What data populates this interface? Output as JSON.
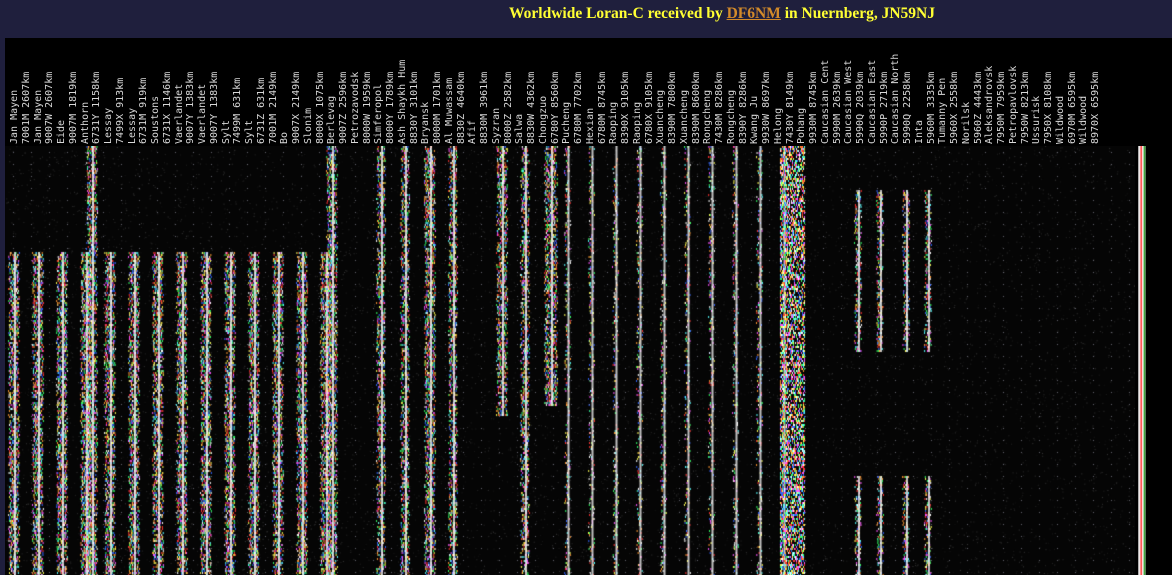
{
  "header": {
    "prefix": "Worldwide Loran-C received by ",
    "link": "DF6NM",
    "suffix": " in Nuernberg, JN59NJ"
  },
  "stations": [
    "Jan Mayen",
    "7001M 2607km",
    "Jan Mayen",
    "9007W 2607km",
    "Eide",
    "9007M 1819km",
    "Anthorn",
    "6731Y 1158km",
    "Lessay",
    "7499X 913km",
    "Lessay",
    "6731M 919km",
    "Soustons",
    "6731X 1146km",
    "Vaerlandet",
    "9007Y 1383km",
    "Vaerlandet",
    "9007Y 1383km",
    "Sylt",
    "7499M 631km",
    "Sylt",
    "6731Z 631km",
    "7001M 2149km",
    "Bo",
    "9007X 2149km",
    "Slonim",
    "8000X 1075km",
    "Berlevag",
    "9007Z 2596km",
    "Petrozavodsk",
    "8000W 1959km",
    "Simferopol",
    "8000Y 1789km",
    "Ash Shaykh Hum",
    "8830Y 3101km",
    "Bryansk",
    "8000M 1701km",
    "Al Muwassam",
    "8830Z 4640km",
    "Afif",
    "8830M 3961km",
    "Syzran",
    "8000Z 2582km",
    "Salwa",
    "8830W 4362km",
    "Chongzuo",
    "6780Y 8560km",
    "Pucheng",
    "6780M 7702km",
    "Hexian",
    "6780M 8745km",
    "Raoping",
    "8390X 9105km",
    "Raoping",
    "6780X 9105km",
    "Xuancheng",
    "8390M 7800km",
    "Xuancheng",
    "8390M 8600km",
    "Rongcheng",
    "7430M 8286km",
    "Rongcheng",
    "8390Y 8286km",
    "Kwang Ju",
    "9930W 8697km",
    "Helong",
    "7430Y 8149km",
    "Pohang",
    "9930M 8745km",
    "Caucasian Cent",
    "5990M 2639km",
    "Caucasian West",
    "5990Q 2039km",
    "Caucasian East",
    "5990P 2719km",
    "Caucasian North",
    "5990Q 2258km",
    "Inta",
    "5960M 3335km",
    "Tumanny Pen",
    "5960X 2558km",
    "Norilsk",
    "5960Z 4443km",
    "Aleksandrovsk",
    "7950M 7959km",
    "Petropavlovsk",
    "7950W 8213km",
    "Ussurisk",
    "7950X 8108km",
    "Wildwood",
    "6970M 6595km",
    "Wildwood",
    "8970X 6595km"
  ]
}
